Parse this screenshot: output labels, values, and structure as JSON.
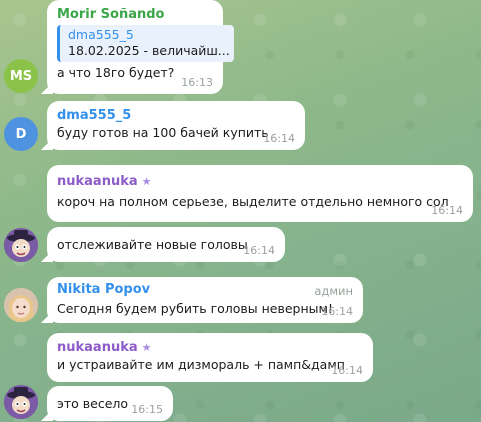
{
  "colors": {
    "morir": "#3aa648",
    "dma": "#3390ec",
    "nukaanuka": "#8c5cc9",
    "nikita": "#3390ec",
    "avatar_ms": "#8bc34a",
    "avatar_d": "#4e93e0"
  },
  "messages": [
    {
      "sender": "Morir Soñando",
      "reply_author": "dma555_5",
      "reply_text": "18.02.2025 - величайш...",
      "text": "а что 18го будет?",
      "time": "16:13",
      "avatar_initials": "MS"
    },
    {
      "sender": "dma555_5",
      "text": "буду готов на 100 бачей купить",
      "time": "16:14",
      "avatar_initials": "D"
    },
    {
      "sender": "nukaanuka",
      "sender_star": "★",
      "text": "короч на полном серьезе, выделите отдельно немного сол",
      "time": "16:14"
    },
    {
      "text": "отслеживайте новые головы",
      "time": "16:14",
      "avatar_icon": "cartoon-hat-avatar-icon"
    },
    {
      "sender": "Nikita Popov",
      "role": "админ",
      "text": "Сегодня будем рубить головы неверным!",
      "time": "16:14",
      "avatar_icon": "child-photo-avatar-icon"
    },
    {
      "sender": "nukaanuka",
      "sender_star": "★",
      "text": "и устраивайте им дизмораль + памп&дамп",
      "time": "16:14"
    },
    {
      "text": "это весело",
      "time": "16:15",
      "avatar_icon": "cartoon-hat-avatar-icon"
    }
  ]
}
